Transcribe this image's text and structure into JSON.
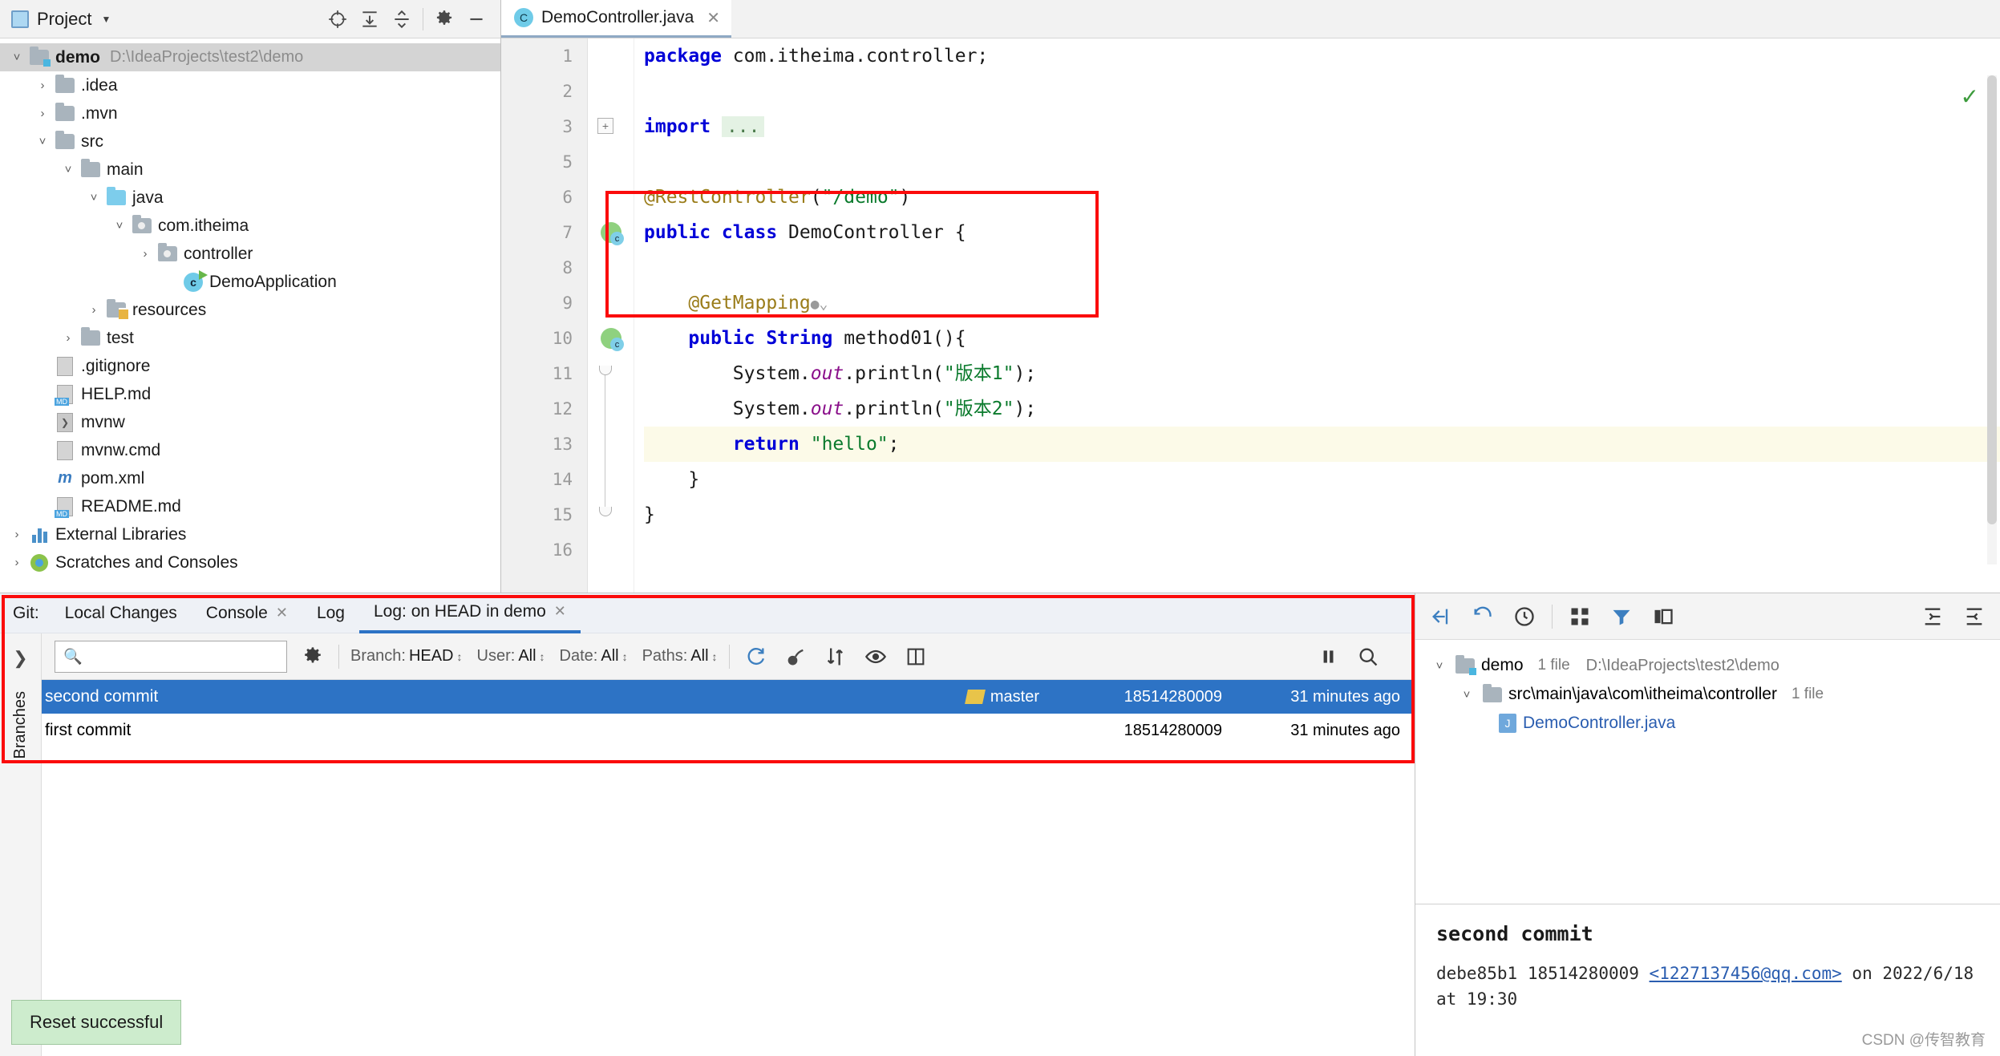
{
  "project_panel": {
    "title": "Project",
    "caret_icon": "chevron-down-icon",
    "tools": [
      "locate-icon",
      "expand-all-icon",
      "collapse-all-icon",
      "gear-icon",
      "minimize-icon"
    ],
    "tree": [
      {
        "label": "demo",
        "path": "D:\\IdeaProjects\\test2\\demo",
        "depth": 0,
        "arrow": "down",
        "icon": "folder-module",
        "bold": true,
        "selected": true
      },
      {
        "label": ".idea",
        "path": "",
        "depth": 1,
        "arrow": "right",
        "icon": "folder",
        "bold": false,
        "selected": false
      },
      {
        "label": ".mvn",
        "path": "",
        "depth": 1,
        "arrow": "right",
        "icon": "folder",
        "bold": false,
        "selected": false
      },
      {
        "label": "src",
        "path": "",
        "depth": 1,
        "arrow": "down",
        "icon": "folder",
        "bold": false,
        "selected": false
      },
      {
        "label": "main",
        "path": "",
        "depth": 2,
        "arrow": "down",
        "icon": "folder",
        "bold": false,
        "selected": false
      },
      {
        "label": "java",
        "path": "",
        "depth": 3,
        "arrow": "down",
        "icon": "folder-source",
        "bold": false,
        "selected": false
      },
      {
        "label": "com.itheima",
        "path": "",
        "depth": 4,
        "arrow": "down",
        "icon": "folder-package",
        "bold": false,
        "selected": false
      },
      {
        "label": "controller",
        "path": "",
        "depth": 5,
        "arrow": "right",
        "icon": "folder-package",
        "bold": false,
        "selected": false
      },
      {
        "label": "DemoApplication",
        "path": "",
        "depth": 6,
        "arrow": "none",
        "icon": "spring-class",
        "bold": false,
        "selected": false
      },
      {
        "label": "resources",
        "path": "",
        "depth": 3,
        "arrow": "right",
        "icon": "folder-resources",
        "bold": false,
        "selected": false
      },
      {
        "label": "test",
        "path": "",
        "depth": 2,
        "arrow": "right",
        "icon": "folder",
        "bold": false,
        "selected": false
      },
      {
        "label": ".gitignore",
        "path": "",
        "depth": 1,
        "arrow": "none",
        "icon": "file",
        "bold": false,
        "selected": false
      },
      {
        "label": "HELP.md",
        "path": "",
        "depth": 1,
        "arrow": "none",
        "icon": "file-markdown",
        "bold": false,
        "selected": false
      },
      {
        "label": "mvnw",
        "path": "",
        "depth": 1,
        "arrow": "none",
        "icon": "file-script",
        "bold": false,
        "selected": false
      },
      {
        "label": "mvnw.cmd",
        "path": "",
        "depth": 1,
        "arrow": "none",
        "icon": "file-text",
        "bold": false,
        "selected": false
      },
      {
        "label": "pom.xml",
        "path": "",
        "depth": 1,
        "arrow": "none",
        "icon": "maven-icon",
        "bold": false,
        "selected": false
      },
      {
        "label": "README.md",
        "path": "",
        "depth": 1,
        "arrow": "none",
        "icon": "file-markdown",
        "bold": false,
        "selected": false
      },
      {
        "label": "External Libraries",
        "path": "",
        "depth": 0,
        "arrow": "right",
        "icon": "library-icon",
        "bold": false,
        "selected": false
      },
      {
        "label": "Scratches and Consoles",
        "path": "",
        "depth": 0,
        "arrow": "right",
        "icon": "scratches-icon",
        "bold": false,
        "selected": false
      }
    ]
  },
  "editor": {
    "tab": {
      "label": "DemoController.java",
      "icon_letter": "C",
      "close_icon": "close-icon"
    },
    "inspection_status_icon": "checkmark-icon",
    "lines": [
      {
        "n": "1",
        "tokens": [
          {
            "t": "package ",
            "c": "kw"
          },
          {
            "t": "com.itheima.controller;",
            "c": "plain"
          }
        ]
      },
      {
        "n": "2",
        "tokens": []
      },
      {
        "n": "3",
        "tokens": [
          {
            "t": "import ",
            "c": "kw"
          },
          {
            "t": "...",
            "c": "fold"
          }
        ]
      },
      {
        "n": "5",
        "tokens": []
      },
      {
        "n": "6",
        "tokens": [
          {
            "t": "@RestController",
            "c": "ann"
          },
          {
            "t": "(",
            "c": "plain"
          },
          {
            "t": "\"/demo\"",
            "c": "str"
          },
          {
            "t": ")",
            "c": "plain"
          }
        ]
      },
      {
        "n": "7",
        "tokens": [
          {
            "t": "public class ",
            "c": "kw"
          },
          {
            "t": "DemoController {",
            "c": "plain"
          }
        ]
      },
      {
        "n": "8",
        "tokens": []
      },
      {
        "n": "9",
        "tokens": [
          {
            "t": "    @GetMapping",
            "c": "ann"
          },
          {
            "t": "●⌄",
            "c": "gutterglyph"
          }
        ]
      },
      {
        "n": "10",
        "tokens": [
          {
            "t": "    public String ",
            "c": "kw"
          },
          {
            "t": "method01(){",
            "c": "plain"
          }
        ]
      },
      {
        "n": "11",
        "tokens": [
          {
            "t": "        System.",
            "c": "plain"
          },
          {
            "t": "out",
            "c": "stat"
          },
          {
            "t": ".println(",
            "c": "plain"
          },
          {
            "t": "\"版本1\"",
            "c": "str"
          },
          {
            "t": ");",
            "c": "plain"
          }
        ]
      },
      {
        "n": "12",
        "tokens": [
          {
            "t": "        System.",
            "c": "plain"
          },
          {
            "t": "out",
            "c": "stat"
          },
          {
            "t": ".println(",
            "c": "plain"
          },
          {
            "t": "\"版本2\"",
            "c": "str"
          },
          {
            "t": ");",
            "c": "plain"
          }
        ]
      },
      {
        "n": "13",
        "tokens": [
          {
            "t": "        return ",
            "c": "kw"
          },
          {
            "t": "\"hello\"",
            "c": "str"
          },
          {
            "t": ";",
            "c": "plain"
          }
        ],
        "highlight": true
      },
      {
        "n": "14",
        "tokens": [
          {
            "t": "    }",
            "c": "plain"
          }
        ]
      },
      {
        "n": "15",
        "tokens": [
          {
            "t": "}",
            "c": "plain"
          }
        ]
      },
      {
        "n": "16",
        "tokens": []
      }
    ]
  },
  "git_panel": {
    "tabs": [
      {
        "label": "Git:",
        "closable": false,
        "active": false,
        "is_label": true
      },
      {
        "label": "Local Changes",
        "closable": false,
        "active": false,
        "is_label": false
      },
      {
        "label": "Console",
        "closable": true,
        "active": false,
        "is_label": false
      },
      {
        "label": "Log",
        "closable": false,
        "active": false,
        "is_label": false
      },
      {
        "label": "Log: on HEAD in demo",
        "closable": true,
        "active": true,
        "is_label": false
      }
    ],
    "settings_icon": "gear-icon",
    "minimize_icon": "minimize-icon",
    "toolbar": {
      "search_placeholder": "",
      "search_icon": "search-icon",
      "gear_icon": "gear-icon",
      "filters": [
        {
          "name": "Branch:",
          "value": "HEAD"
        },
        {
          "name": "User:",
          "value": "All"
        },
        {
          "name": "Date:",
          "value": "All"
        },
        {
          "name": "Paths:",
          "value": "All"
        }
      ],
      "icons": [
        "refresh-icon",
        "cherry-pick-icon",
        "sort-icon",
        "eye-icon",
        "diff-icon"
      ],
      "right_icons": [
        "pause-icon",
        "search-icon"
      ]
    },
    "branches_label": "Branches",
    "branches_expand_icon": "chevron-right-icon",
    "commits": [
      {
        "message": "second commit",
        "tag": "master",
        "author": "18514280009",
        "date": "31 minutes ago",
        "selected": true
      },
      {
        "message": "first commit",
        "tag": "",
        "author": "18514280009",
        "date": "31 minutes ago",
        "selected": false
      }
    ],
    "changes": {
      "toolbar_icons": [
        "expand-icon",
        "revert-icon",
        "history-icon",
        "group-icon",
        "filter-icon",
        "layout-icon",
        "align-left-icon",
        "align-right-icon"
      ],
      "root": {
        "label": "demo",
        "count": "1 file",
        "path": "D:\\IdeaProjects\\test2\\demo"
      },
      "folder": {
        "label": "src\\main\\java\\com\\itheima\\controller",
        "count": "1 file"
      },
      "file": {
        "label": "DemoController.java",
        "icon": "java-file-icon"
      }
    },
    "detail": {
      "title": "second commit",
      "hash": "debe85b1",
      "author": "18514280009",
      "email": "<1227137456@qq.com>",
      "on_text": "on 2022/6/18 at 19:30"
    }
  },
  "toast": {
    "message": "Reset successful"
  },
  "watermark": "CSDN @传智教育",
  "colors": {
    "accent": "#2d73c5",
    "red_box": "#fb0b0b",
    "toast_bg": "#cdeccd"
  }
}
